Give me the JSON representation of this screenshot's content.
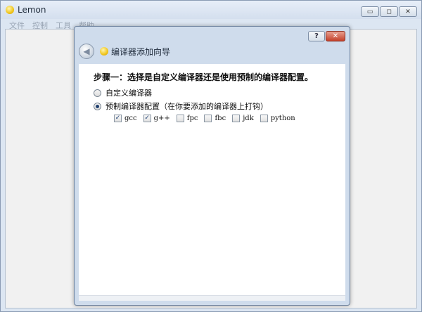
{
  "main_window": {
    "title": "Lemon",
    "app_icon": "lemon-icon",
    "controls": {
      "minimize": "▭",
      "maximize": "◻",
      "close": "✕"
    },
    "menu": [
      "文件",
      "控制",
      "工具",
      "帮助"
    ]
  },
  "dialog": {
    "title": "编译器添加向导",
    "controls": {
      "help": "?",
      "close": "✕"
    },
    "back_glyph": "◀",
    "step_heading": "步骤一：选择是自定义编译器还是使用预制的编译器配置。",
    "options": [
      {
        "label": "自定义编译器",
        "selected": false
      },
      {
        "label": "预制编译器配置（在你要添加的编译器上打钩）",
        "selected": true
      }
    ],
    "compilers": [
      {
        "label": "gcc",
        "checked": true
      },
      {
        "label": "g++",
        "checked": true
      },
      {
        "label": "fpc",
        "checked": false
      },
      {
        "label": "fbc",
        "checked": false
      },
      {
        "label": "jdk",
        "checked": false
      },
      {
        "label": "python",
        "checked": false
      }
    ],
    "check_glyph": "✓"
  }
}
